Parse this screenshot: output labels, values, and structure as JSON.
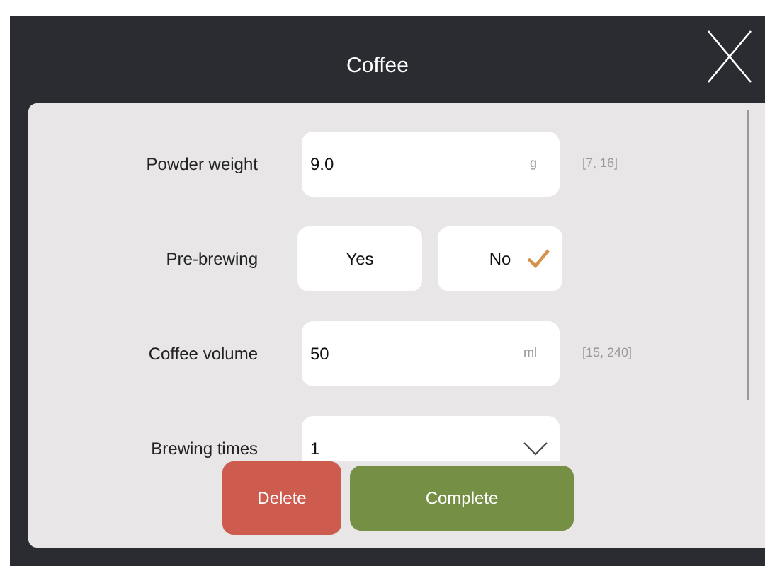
{
  "window": {
    "title": "Coffee"
  },
  "fields": [
    {
      "kind": "number",
      "label": "Powder weight",
      "value": "9.0",
      "unit": "g",
      "range": "[7, 16]"
    },
    {
      "kind": "choice",
      "label": "Pre-brewing",
      "options": [
        {
          "label": "Yes",
          "selected": false
        },
        {
          "label": "No",
          "selected": true
        }
      ]
    },
    {
      "kind": "number",
      "label": "Coffee volume",
      "value": "50",
      "unit": "ml",
      "range": "[15, 240]"
    },
    {
      "kind": "dropdown",
      "label": "Brewing times",
      "value": "1"
    }
  ],
  "buttons": [
    {
      "kind": "danger",
      "label": "Delete"
    },
    {
      "kind": "primary",
      "label": "Complete"
    }
  ]
}
